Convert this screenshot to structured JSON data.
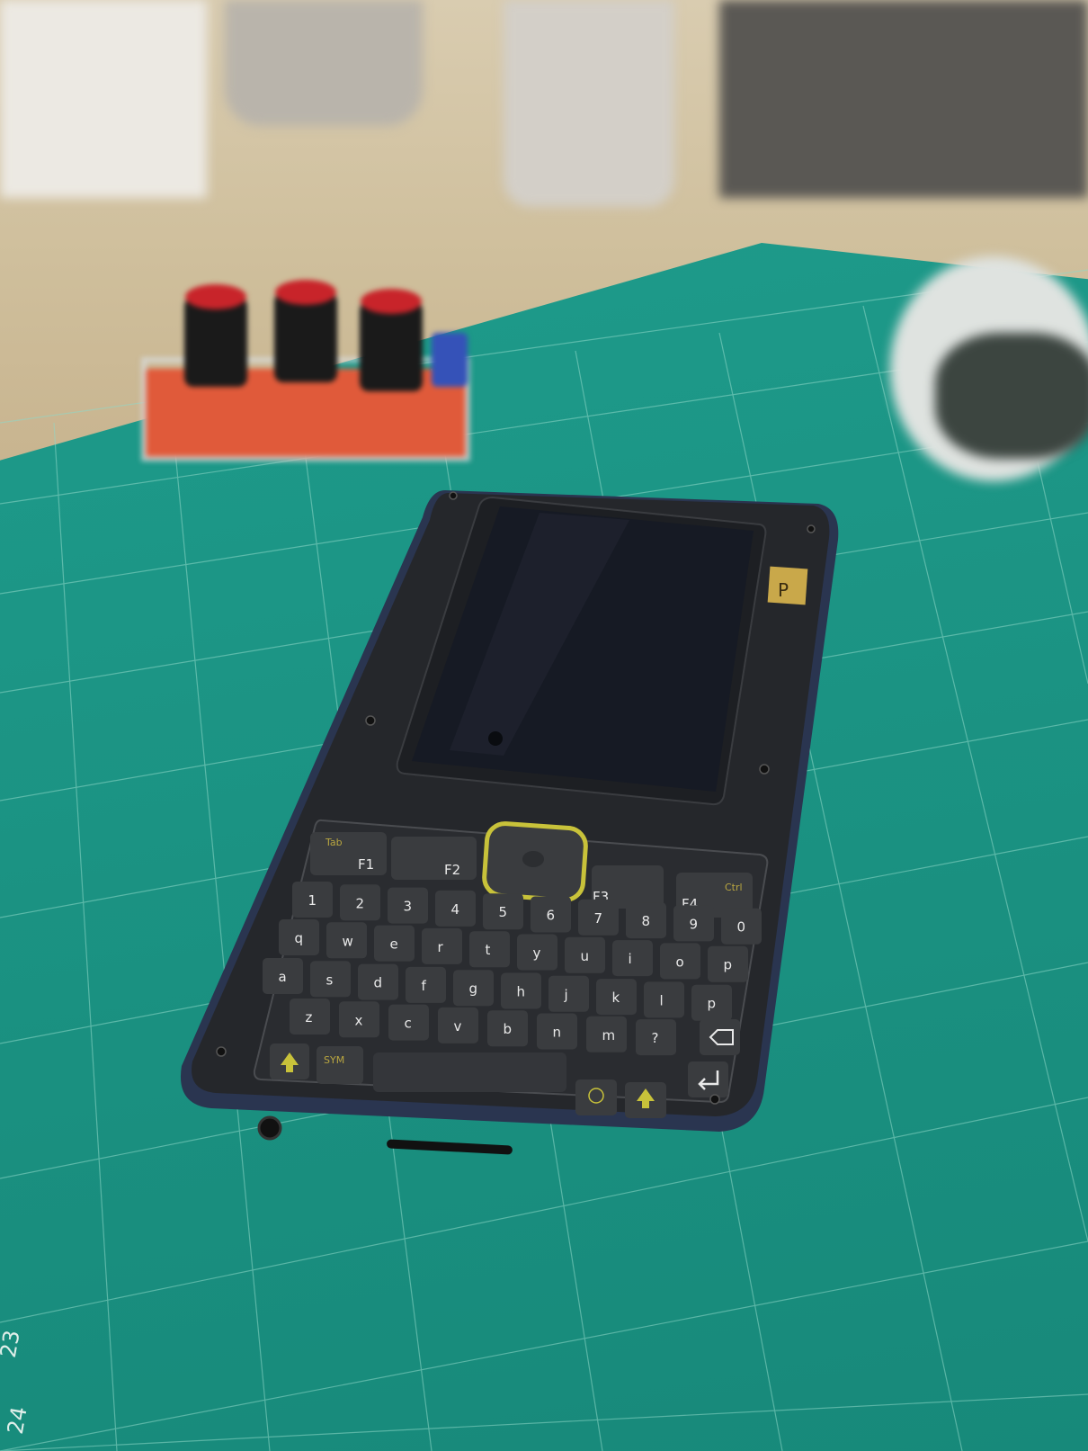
{
  "scene": {
    "screen_key": "P",
    "function_keys": [
      "F1",
      "F2",
      "F3",
      "F4"
    ],
    "tab_label": "Tab",
    "ctrl_label": "Ctrl",
    "row_numbers": [
      "1",
      "2",
      "3",
      "4",
      "5",
      "6",
      "7",
      "8",
      "9",
      "0"
    ],
    "row_q": [
      "q",
      "w",
      "e",
      "r",
      "t",
      "y",
      "u",
      "i",
      "o",
      "p"
    ],
    "row_a": [
      "a",
      "s",
      "d",
      "f",
      "g",
      "h",
      "j",
      "k",
      "l",
      "p"
    ],
    "row_z": [
      "z",
      "x",
      "c",
      "v",
      "b",
      "n",
      "m",
      "?"
    ],
    "sym_label": "SYM",
    "mat_numbers": [
      "23",
      "24"
    ],
    "colors": {
      "mat": "#1e9b8b",
      "phone_body": "#25272b",
      "phone_edge": "#2a3550",
      "screen": "#161a24",
      "accent_yellow": "#c8c23a",
      "gold_pad": "#c9a84a"
    }
  }
}
